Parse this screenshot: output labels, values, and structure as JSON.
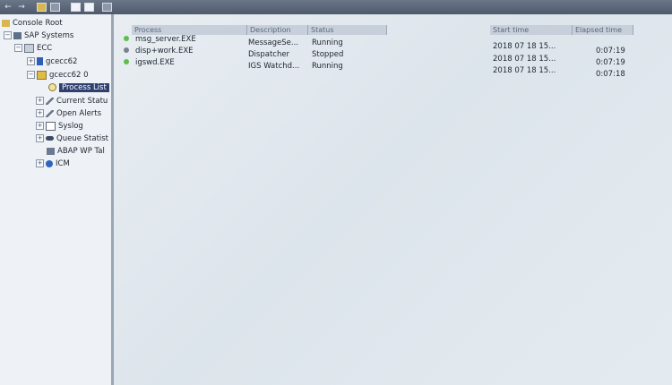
{
  "toolbar": {
    "icons": [
      "back-arrow-icon",
      "forward-arrow-icon",
      "console-icon",
      "properties-icon",
      "refresh-icon",
      "list-icon",
      "export-icon"
    ]
  },
  "tree": {
    "root": "Console Root",
    "sap_systems": "SAP Systems",
    "ecc": "ECC",
    "gcecc62": "gcecc62",
    "gcecc62_0": "gcecc62 0",
    "process_list": "Process List",
    "current_status": "Current Statu",
    "open_alerts": "Open Alerts",
    "syslog": "Syslog",
    "queue_statistics": "Queue Statist",
    "abap_wp_table": "ABAP WP Tal",
    "icm": "ICM"
  },
  "columns": {
    "process": "Process",
    "description": "Description",
    "status": "Status",
    "start_time": "Start time",
    "elapsed_time": "Elapsed time"
  },
  "rows": [
    {
      "process": "msg_server.EXE",
      "description": "MessageSe...",
      "status": "Running",
      "start_time": "2018 07 18 15...",
      "elapsed": "0:07:19",
      "status_color": "#5bbf4a"
    },
    {
      "process": "disp+work.EXE",
      "description": "Dispatcher",
      "status": "Stopped",
      "start_time": "2018 07 18 15...",
      "elapsed": "0:07:19",
      "status_color": "#7a8290"
    },
    {
      "process": "igswd.EXE",
      "description": "IGS Watchd...",
      "status": "Running",
      "start_time": "2018 07 18 15...",
      "elapsed": "0:07:18",
      "status_color": "#5bbf4a"
    }
  ]
}
